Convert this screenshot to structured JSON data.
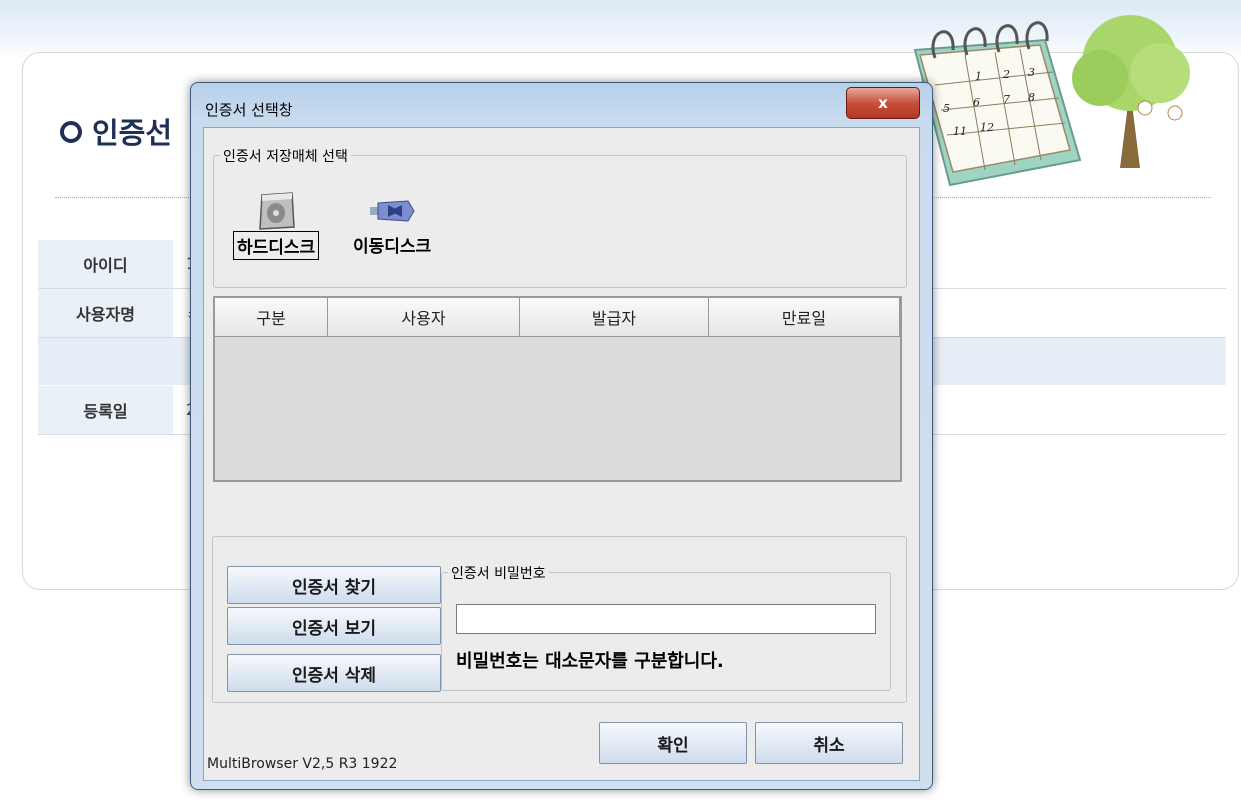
{
  "background": {
    "page_title": "인증선",
    "rows": [
      {
        "label": "아이디",
        "value": "1"
      },
      {
        "label": "사용자명",
        "value": "ㅋ"
      },
      {
        "label": "등록일",
        "value": "2"
      }
    ],
    "calendar_numbers": [
      "1",
      "2",
      "3",
      "5",
      "6",
      "7",
      "8",
      "11",
      "12"
    ]
  },
  "dialog": {
    "title": "인증서 선택창",
    "close_label": "x",
    "storage_group_title": "인증서 저장매체 선택",
    "media": [
      {
        "label": "하드디스크",
        "icon": "hard-disk-icon",
        "selected": true
      },
      {
        "label": "이동디스크",
        "icon": "usb-drive-icon",
        "selected": false
      }
    ],
    "table_columns": [
      "구분",
      "사용자",
      "발급자",
      "만료일"
    ],
    "buttons": {
      "find": "인증서 찾기",
      "view": "인증서 보기",
      "delete": "인증서 삭제",
      "ok": "확인",
      "cancel": "취소"
    },
    "password_group_title": "인증서 비밀번호",
    "password_value": "",
    "password_hint": "비밀번호는 대소문자를 구분합니다.",
    "version": "MultiBrowser V2,5 R3 1922"
  }
}
